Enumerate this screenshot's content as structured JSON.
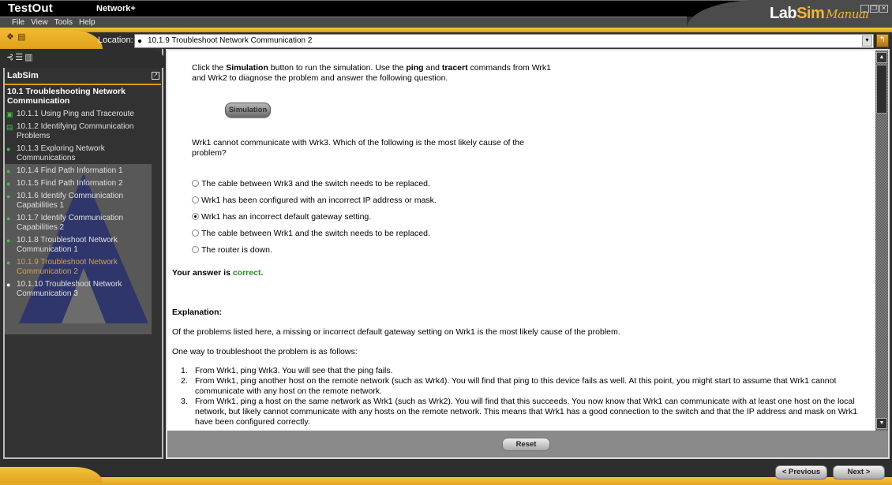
{
  "window": {
    "brand": "TestOut",
    "course": "Network+",
    "logo": {
      "main_a": "Lab",
      "main_b": "Sim",
      "sub": "Manual"
    },
    "controls": [
      "minimize",
      "restore",
      "close"
    ]
  },
  "menu": [
    {
      "label": "File",
      "accel": "F"
    },
    {
      "label": "View",
      "accel": "V"
    },
    {
      "label": "Tools",
      "accel": "T"
    },
    {
      "label": "Help",
      "accel": "H"
    }
  ],
  "toolbar": {
    "icons": [
      "bookmarks-icon",
      "print-icon"
    ],
    "location_label": "Location:",
    "location_value": "10.1.9 Troubleshoot Network Communication 2"
  },
  "sidebar": {
    "header": "LabSim",
    "section_title": "10.1 Troubleshooting Network Communication",
    "items": [
      {
        "label": "10.1.1 Using Ping and Traceroute",
        "icon": "video-icon",
        "state": "done"
      },
      {
        "label": "10.1.2 Identifying Communication Problems",
        "icon": "document-icon",
        "state": "done"
      },
      {
        "label": "10.1.3 Exploring Network Communications",
        "icon": "lab-icon",
        "state": "done"
      },
      {
        "label": "10.1.4 Find Path Information 1",
        "icon": "lab-icon",
        "state": "done"
      },
      {
        "label": "10.1.5 Find Path Information 2",
        "icon": "lab-icon",
        "state": "done"
      },
      {
        "label": "10.1.6 Identify Communication Capabilities 1",
        "icon": "lab-icon",
        "state": "done"
      },
      {
        "label": "10.1.7 Identify Communication Capabilities 2",
        "icon": "lab-icon",
        "state": "done"
      },
      {
        "label": "10.1.8 Troubleshoot Network Communication 1",
        "icon": "lab-icon",
        "state": "done"
      },
      {
        "label": "10.1.9 Troubleshoot Network Communication 2",
        "icon": "lab-icon",
        "state": "current"
      },
      {
        "label": "10.1.10 Troubleshoot Network Communication 3",
        "icon": "lab-icon",
        "state": "todo"
      }
    ]
  },
  "content": {
    "intro": {
      "t1": "Click the ",
      "b1": "Simulation",
      "t2": " button to run the simulation. Use the ",
      "b2": "ping",
      "t3": " and ",
      "b3": "tracert",
      "t4": " commands from Wrk1 and Wrk2 to diagnose the problem and answer the following question."
    },
    "simulation_button": "Simulation",
    "question": "Wrk1 cannot communicate with Wrk3. Which of the following is the most likely cause of the problem?",
    "options": [
      {
        "label": "The cable between Wrk3 and the switch needs to be replaced.",
        "selected": false
      },
      {
        "label": "Wrk1 has been configured with an incorrect IP address or mask.",
        "selected": false
      },
      {
        "label": "Wrk1 has an incorrect default gateway setting.",
        "selected": true
      },
      {
        "label": "The cable between Wrk1 and the switch needs to be replaced.",
        "selected": false
      },
      {
        "label": "The router is down.",
        "selected": false
      }
    ],
    "result_prefix": "Your answer is ",
    "result_value": "correct.",
    "result_color": "#2a8a2a",
    "explanation_heading": "Explanation:",
    "explanation_p1": "Of the problems listed here, a missing or incorrect default gateway setting on Wrk1 is the most likely cause of the problem.",
    "explanation_p2": "One way to troubleshoot the problem is as follows:",
    "steps": [
      {
        "num": "1.",
        "text": "From Wrk1, ping Wrk3. You will see that the ping fails."
      },
      {
        "num": "2.",
        "text": "From Wrk1, ping another host on the remote network (such as Wrk4). You will find that ping to this device fails as well. At this point, you might start to assume that Wrk1 cannot communicate with any host on the remote network."
      },
      {
        "num": "3.",
        "text": "From Wrk1, ping a host on the same network as Wrk1 (such as Wrk2). You will find that this succeeds. You now know that Wrk1 can communicate with at least one host on the local network, but likely cannot communicate with any hosts on the remote network. This means that Wrk1 has a good connection to the switch and that the IP address and mask on Wrk1 have been configured correctly."
      }
    ],
    "reset_button": "Reset"
  },
  "navigation": {
    "previous": "< Previous",
    "next": "Next >"
  },
  "colors": {
    "accent_gold": "#f1b82d",
    "chrome_dark": "#2e2e2e",
    "current_item": "#c9a25a",
    "done_icon": "#3fc23f"
  }
}
